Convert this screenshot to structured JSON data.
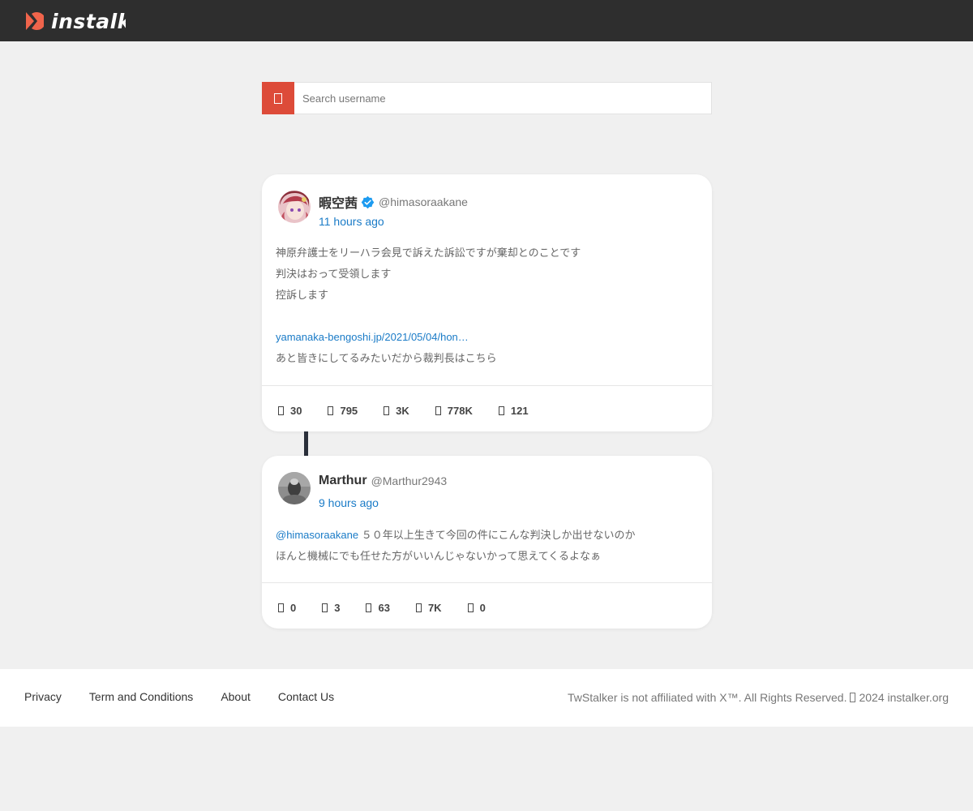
{
  "brand": {
    "name": "instalk",
    "accent": "#f0644b"
  },
  "search": {
    "placeholder": "Search username",
    "icon": "search-icon",
    "button_color": "#dd4b39"
  },
  "tweets": [
    {
      "display_name": "暇空茜",
      "verified": true,
      "handle": "@himasoraakane",
      "time": "11 hours ago",
      "lines": [
        "神原弁護士をリーハラ会見で訴えた訴訟ですが棄却とのことです",
        "判決はおって受領します",
        "控訴します",
        "",
        "yamanaka-bengoshi.jp/2021/05/04/hon…",
        "あと皆きにしてるみたいだから裁判長はこちら"
      ],
      "stats": {
        "replies": "30",
        "retweets": "795",
        "quotes": "3K",
        "views": "778K",
        "bookmarks": "121"
      }
    },
    {
      "display_name": "Marthur",
      "verified": false,
      "handle": "@Marthur2943",
      "time": "9 hours ago",
      "mention": "@himasoraakane",
      "lines": [
        "５０年以上生きて今回の件にこんな判決しか出せないのか",
        "ほんと機械にでも任せた方がいいんじゃないかって思えてくるよなぁ"
      ],
      "stats": {
        "replies": "0",
        "retweets": "3",
        "quotes": "63",
        "views": "7K",
        "bookmarks": "0"
      }
    }
  ],
  "footer": {
    "links": [
      "Privacy",
      "Term and Conditions",
      "About",
      "Contact Us"
    ],
    "notice": "TwStalker is not affiliated with X™. All Rights Reserved.",
    "copyright": "2024 instalker.org"
  },
  "colors": {
    "header": "#2e2e2e",
    "link": "#1a7bc7",
    "background": "#f0f0f0"
  }
}
